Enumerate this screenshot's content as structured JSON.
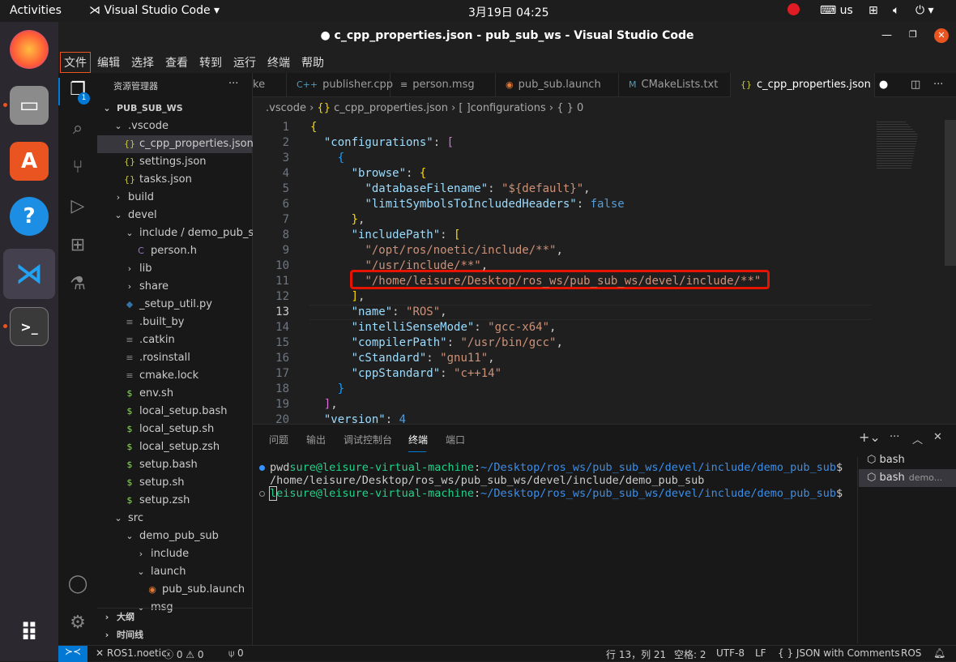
{
  "topbar": {
    "activities": "Activities",
    "app": "Visual Studio Code ▾",
    "clock": "3月19日  04:25",
    "keyboard": "us"
  },
  "window": {
    "title": "● c_cpp_properties.json - pub_sub_ws - Visual Studio Code"
  },
  "menu": [
    "文件",
    "编辑",
    "选择",
    "查看",
    "转到",
    "运行",
    "终端",
    "帮助"
  ],
  "explorer": {
    "title": "资源管理器",
    "root": "PUB_SUB_WS",
    "badge": "1",
    "items": [
      {
        "label": ".vscode",
        "icon": "chevron-down",
        "indent": 1
      },
      {
        "label": "c_cpp_properties.json",
        "icon": "{}",
        "indent": 2,
        "selected": true
      },
      {
        "label": "settings.json",
        "icon": "{}",
        "indent": 2
      },
      {
        "label": "tasks.json",
        "icon": "{}",
        "indent": 2
      },
      {
        "label": "build",
        "icon": "chevron-right",
        "indent": 1
      },
      {
        "label": "devel",
        "icon": "chevron-down",
        "indent": 1
      },
      {
        "label": "include / demo_pub_sub",
        "icon": "chevron-down",
        "indent": 2
      },
      {
        "label": "person.h",
        "icon": "C",
        "indent": 3
      },
      {
        "label": "lib",
        "icon": "chevron-right",
        "indent": 2
      },
      {
        "label": "share",
        "icon": "chevron-right",
        "indent": 2
      },
      {
        "label": "_setup_util.py",
        "icon": "py",
        "indent": 2
      },
      {
        "label": ".built_by",
        "icon": "≡",
        "indent": 2
      },
      {
        "label": ".catkin",
        "icon": "≡",
        "indent": 2
      },
      {
        "label": ".rosinstall",
        "icon": "≡",
        "indent": 2
      },
      {
        "label": "cmake.lock",
        "icon": "≡",
        "indent": 2
      },
      {
        "label": "env.sh",
        "icon": "$",
        "indent": 2
      },
      {
        "label": "local_setup.bash",
        "icon": "$",
        "indent": 2
      },
      {
        "label": "local_setup.sh",
        "icon": "$",
        "indent": 2
      },
      {
        "label": "local_setup.zsh",
        "icon": "$",
        "indent": 2
      },
      {
        "label": "setup.bash",
        "icon": "$",
        "indent": 2
      },
      {
        "label": "setup.sh",
        "icon": "$",
        "indent": 2
      },
      {
        "label": "setup.zsh",
        "icon": "$",
        "indent": 2
      },
      {
        "label": "src",
        "icon": "chevron-down",
        "indent": 1
      },
      {
        "label": "demo_pub_sub",
        "icon": "chevron-down",
        "indent": 2
      },
      {
        "label": "include",
        "icon": "chevron-right",
        "indent": 3
      },
      {
        "label": "launch",
        "icon": "chevron-down",
        "indent": 3
      },
      {
        "label": "pub_sub.launch",
        "icon": "rss",
        "indent": 4
      },
      {
        "label": "msg",
        "icon": "chevron-down",
        "indent": 3
      }
    ],
    "outline": "大纲",
    "timeline": "时间线"
  },
  "tabs": [
    {
      "label": "ke",
      "icon": ""
    },
    {
      "label": "publisher.cpp",
      "icon": "C++"
    },
    {
      "label": "person.msg",
      "icon": "≡"
    },
    {
      "label": "pub_sub.launch",
      "icon": "rss"
    },
    {
      "label": "CMakeLists.txt",
      "icon": "M"
    },
    {
      "label": "c_cpp_properties.json",
      "icon": "{}",
      "active": true,
      "modified": true
    }
  ],
  "breadcrumb": [
    ".vscode",
    "c_cpp_properties.json",
    "configurations",
    "0"
  ],
  "code": {
    "current_line": 13,
    "lines": [
      [
        [
          "{",
          "g"
        ]
      ],
      [
        [
          "  ",
          "p"
        ],
        [
          "\"configurations\"",
          "k"
        ],
        [
          ": ",
          "p"
        ],
        [
          "[",
          "m"
        ]
      ],
      [
        [
          "    ",
          "p"
        ],
        [
          "{",
          "c"
        ]
      ],
      [
        [
          "      ",
          "p"
        ],
        [
          "\"browse\"",
          "k"
        ],
        [
          ": ",
          "p"
        ],
        [
          "{",
          "g"
        ]
      ],
      [
        [
          "        ",
          "p"
        ],
        [
          "\"databaseFilename\"",
          "k"
        ],
        [
          ": ",
          "p"
        ],
        [
          "\"${default}\"",
          "s"
        ],
        [
          ",",
          "p"
        ]
      ],
      [
        [
          "        ",
          "p"
        ],
        [
          "\"limitSymbolsToIncludedHeaders\"",
          "k"
        ],
        [
          ": ",
          "p"
        ],
        [
          "false",
          "b"
        ]
      ],
      [
        [
          "      ",
          "p"
        ],
        [
          "}",
          "g"
        ],
        [
          ",",
          "p"
        ]
      ],
      [
        [
          "      ",
          "p"
        ],
        [
          "\"includePath\"",
          "k"
        ],
        [
          ": ",
          "p"
        ],
        [
          "[",
          "g"
        ]
      ],
      [
        [
          "        ",
          "p"
        ],
        [
          "\"/opt/ros/noetic/include/**\"",
          "s"
        ],
        [
          ",",
          "p"
        ]
      ],
      [
        [
          "        ",
          "p"
        ],
        [
          "\"/usr/include/**\"",
          "s"
        ],
        [
          ",",
          "p"
        ]
      ],
      [
        [
          "        ",
          "p"
        ],
        [
          "\"/home/leisure/Desktop/ros_ws/pub_sub_ws/devel/include/**\"",
          "s"
        ]
      ],
      [
        [
          "      ",
          "p"
        ],
        [
          "]",
          "g"
        ],
        [
          ",",
          "p"
        ]
      ],
      [
        [
          "      ",
          "p"
        ],
        [
          "\"name\"",
          "k"
        ],
        [
          ": ",
          "p"
        ],
        [
          "\"ROS\"",
          "s"
        ],
        [
          ",",
          "p"
        ]
      ],
      [
        [
          "      ",
          "p"
        ],
        [
          "\"intelliSenseMode\"",
          "k"
        ],
        [
          ": ",
          "p"
        ],
        [
          "\"gcc-x64\"",
          "s"
        ],
        [
          ",",
          "p"
        ]
      ],
      [
        [
          "      ",
          "p"
        ],
        [
          "\"compilerPath\"",
          "k"
        ],
        [
          ": ",
          "p"
        ],
        [
          "\"/usr/bin/gcc\"",
          "s"
        ],
        [
          ",",
          "p"
        ]
      ],
      [
        [
          "      ",
          "p"
        ],
        [
          "\"cStandard\"",
          "k"
        ],
        [
          ": ",
          "p"
        ],
        [
          "\"gnu11\"",
          "s"
        ],
        [
          ",",
          "p"
        ]
      ],
      [
        [
          "      ",
          "p"
        ],
        [
          "\"cppStandard\"",
          "k"
        ],
        [
          ": ",
          "p"
        ],
        [
          "\"c++14\"",
          "s"
        ]
      ],
      [
        [
          "    ",
          "p"
        ],
        [
          "}",
          "c"
        ]
      ],
      [
        [
          "  ",
          "p"
        ],
        [
          "]",
          "m"
        ],
        [
          ",",
          "p"
        ]
      ],
      [
        [
          "  ",
          "p"
        ],
        [
          "\"version\"",
          "k"
        ],
        [
          ": ",
          "p"
        ],
        [
          "4",
          "b"
        ]
      ]
    ]
  },
  "panel": {
    "tabs": [
      "问题",
      "输出",
      "调试控制台",
      "终端",
      "端口"
    ],
    "active_tab": "终端",
    "terminal": [
      [
        [
          "pwd",
          "#ccc"
        ],
        [
          "sure@leisure-virtual-machine",
          "#23d18b"
        ],
        [
          ":",
          "#ccc"
        ],
        [
          "~/Desktop/ros_ws/pub_sub_ws/devel/include/demo_pub_sub",
          "#3b8eea"
        ],
        [
          "$",
          "#ccc"
        ]
      ],
      [
        [
          "/home/leisure/Desktop/ros_ws/pub_sub_ws/devel/include/demo_pub_sub",
          "#ccc"
        ]
      ],
      [
        [
          "l",
          "#23d18b"
        ],
        [
          "eisure@leisure-virtual-machine",
          "#23d18b"
        ],
        [
          ":",
          "#ccc"
        ],
        [
          "~/Desktop/ros_ws/pub_sub_ws/devel/include/demo_pub_sub",
          "#3b8eea"
        ],
        [
          "$",
          "#ccc"
        ]
      ]
    ],
    "sessions": [
      {
        "label": "bash",
        "detail": ""
      },
      {
        "label": "bash",
        "detail": "demo..."
      }
    ]
  },
  "status": {
    "remote": "ROS1.noetic",
    "errors": "0",
    "warnings": "0",
    "ports": "0",
    "position": "行 13，列 21",
    "spaces": "空格: 2",
    "encoding": "UTF-8",
    "eol": "LF",
    "language": "JSON with Comments",
    "ros": "ROS"
  },
  "colors": {
    "accent": "#0078d4",
    "highlight_box": "#e51400"
  }
}
